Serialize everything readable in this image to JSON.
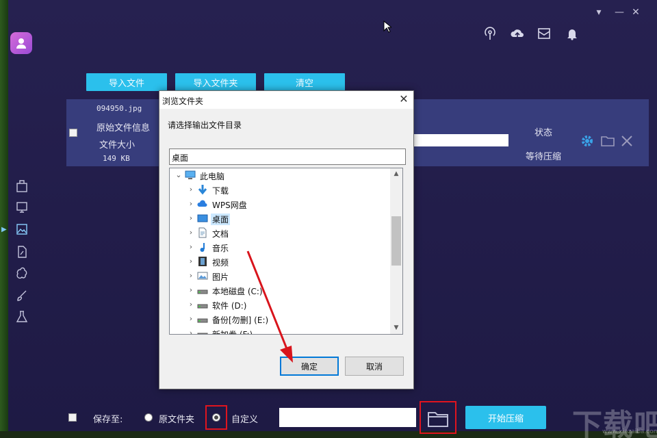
{
  "window": {
    "minimize_label": "▾",
    "restore_label": "—",
    "close_label": "✕"
  },
  "header_icons": [
    "broadcast-icon",
    "cloud-upload-icon",
    "mail-icon",
    "bell-icon"
  ],
  "toolbar": {
    "import_file_label": "导入文件",
    "import_folder_label": "导入文件夹",
    "clear_label": "清空"
  },
  "file_row": {
    "filename": "094950.jpg",
    "original_info_label": "原始文件信息",
    "file_size_label": "文件大小",
    "file_size_value": "149 KB",
    "status_header": "状态",
    "status_value": "等待压缩"
  },
  "sidebar_icons": [
    "app-icon-1",
    "app-icon-2",
    "app-icon-3",
    "app-icon-4",
    "app-icon-5",
    "app-icon-6",
    "app-icon-7"
  ],
  "bottom": {
    "save_to_label": "保存至:",
    "original_folder_label": "原文件夹",
    "custom_label": "自定义",
    "path_value": "",
    "start_label": "开始压缩"
  },
  "watermark": {
    "text": "下载吧",
    "sub": "www.xiazaiba.com"
  },
  "dialog": {
    "title": "浏览文件夹",
    "prompt": "请选择输出文件目录",
    "folder_value": "桌面",
    "tree": [
      {
        "label": "此电脑",
        "icon": "computer-icon",
        "expanded": true,
        "level": 0,
        "selected": false
      },
      {
        "label": "下载",
        "icon": "download-icon",
        "level": 1,
        "selected": false
      },
      {
        "label": "WPS网盘",
        "icon": "cloud-icon",
        "level": 1,
        "selected": false
      },
      {
        "label": "桌面",
        "icon": "desktop-icon",
        "level": 1,
        "selected": true
      },
      {
        "label": "文档",
        "icon": "document-icon",
        "level": 1,
        "selected": false
      },
      {
        "label": "音乐",
        "icon": "music-icon",
        "level": 1,
        "selected": false
      },
      {
        "label": "视频",
        "icon": "video-icon",
        "level": 1,
        "selected": false
      },
      {
        "label": "图片",
        "icon": "picture-icon",
        "level": 1,
        "selected": false
      },
      {
        "label": "本地磁盘 (C:)",
        "icon": "drive-icon",
        "level": 1,
        "selected": false
      },
      {
        "label": "软件 (D:)",
        "icon": "drive-icon",
        "level": 1,
        "selected": false
      },
      {
        "label": "备份[勿删] (E:)",
        "icon": "drive-icon",
        "level": 1,
        "selected": false
      },
      {
        "label": "新加卷 (F:)",
        "icon": "drive-icon",
        "level": 1,
        "selected": false
      }
    ],
    "ok_label": "确定",
    "cancel_label": "取消"
  },
  "colors": {
    "accent": "#2bc0ec",
    "highlight": "#e0141e",
    "selection": "#cce8ff"
  }
}
